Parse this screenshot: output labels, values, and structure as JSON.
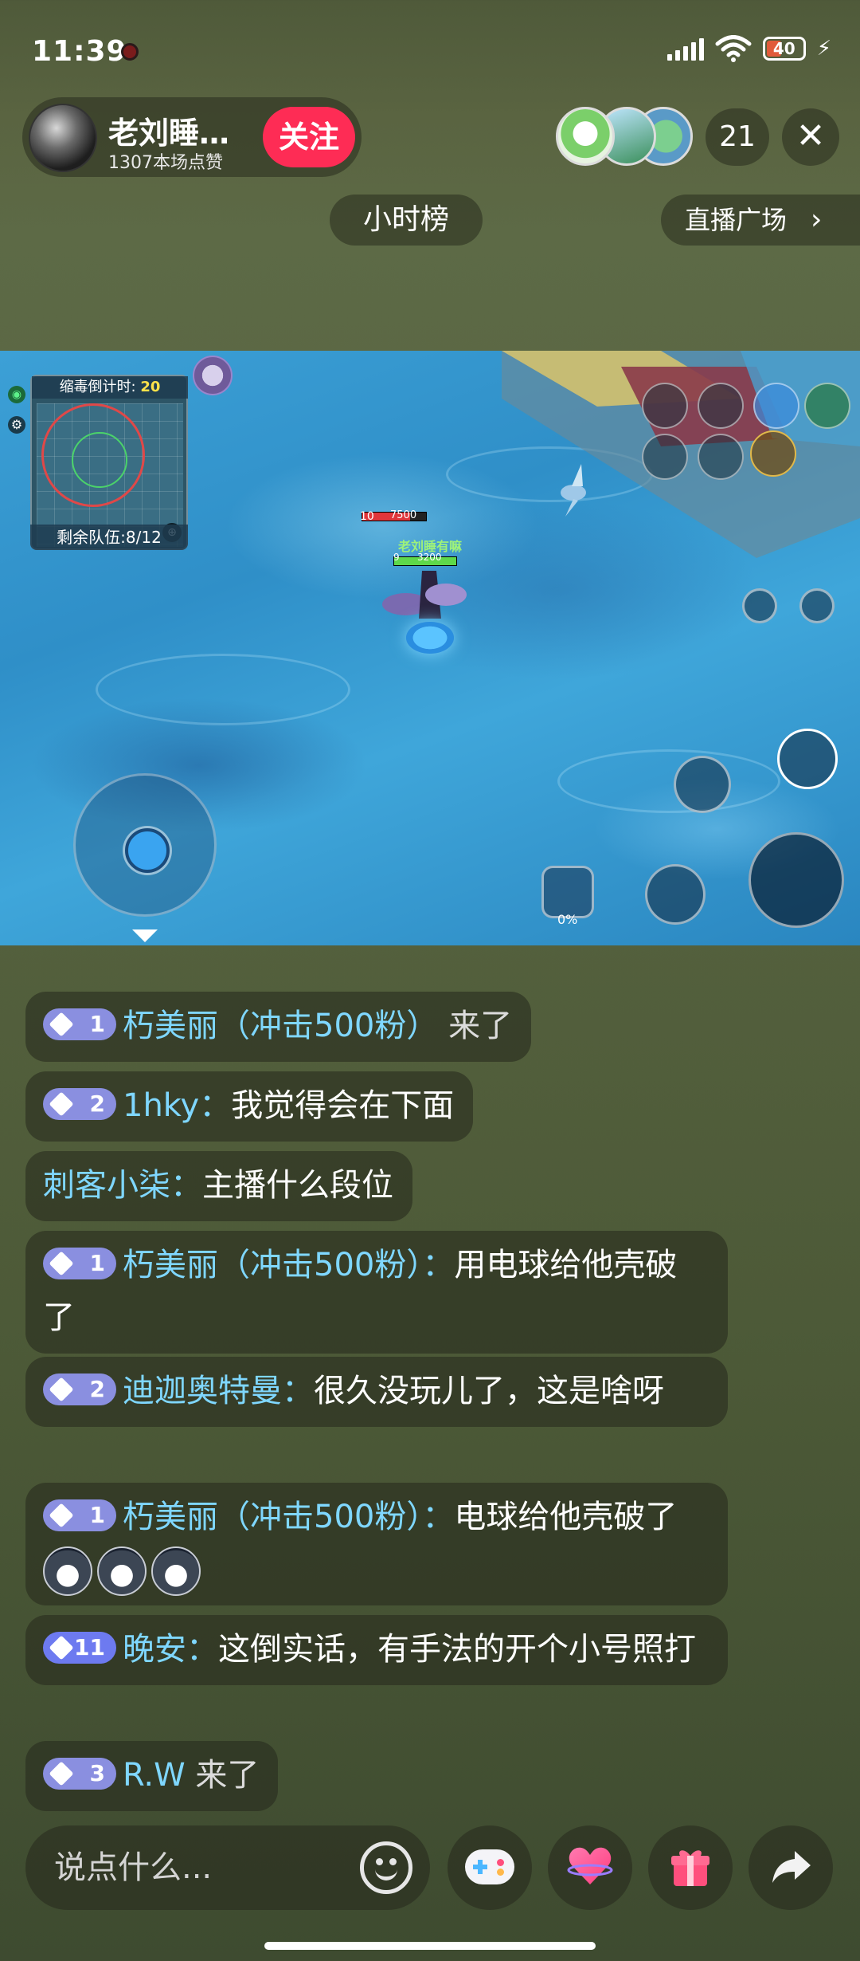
{
  "status_bar": {
    "time": "11:39",
    "battery": "40"
  },
  "streamer": {
    "name": "老刘睡…",
    "likes": "1307本场点赞",
    "follow_label": "关注"
  },
  "viewers": {
    "count": "21"
  },
  "close_icon": "close-icon",
  "rank_label": "小时榜",
  "plaza_label": "直播广场",
  "game": {
    "poison_label": "缩毒倒计时:",
    "poison_value": "20",
    "teams_left_label": "剩余队伍:",
    "teams_left_value": "8/12",
    "enemy_level": "10",
    "enemy_hp": "7500",
    "player_name": "老刘睡有嘛",
    "player_level": "9",
    "player_hp": "3200",
    "percent": "0%"
  },
  "chat": [
    {
      "level": "1",
      "user": "朽美丽（冲击500粉）",
      "text": "来了",
      "type": "join"
    },
    {
      "level": "2",
      "user": "1hky：",
      "text": "我觉得会在下面",
      "type": "msg"
    },
    {
      "level": "",
      "user": "刺客小柒：",
      "text": "主播什么段位",
      "type": "msg"
    },
    {
      "level": "1",
      "user": "朽美丽（冲击500粉）：",
      "text": "用电球给他壳破了",
      "type": "msg"
    },
    {
      "level": "2",
      "user": "迪迦奥特曼：",
      "text": "很久没玩儿了，这是啥呀",
      "type": "msg"
    },
    {
      "level": "1",
      "user": "朽美丽（冲击500粉）：",
      "text": "电球给他壳破了",
      "type": "msg"
    },
    {
      "level": "11",
      "user": "晚安：",
      "text": "这倒实话，有手法的开个小号照打",
      "type": "msg"
    },
    {
      "level": "3",
      "user": "R.W",
      "text": "来了",
      "type": "join"
    }
  ],
  "comment": {
    "placeholder": "说点什么..."
  },
  "colors": {
    "follow": "#fe2c55",
    "username": "#7fd7ff",
    "badge": "#8a8fe0"
  }
}
